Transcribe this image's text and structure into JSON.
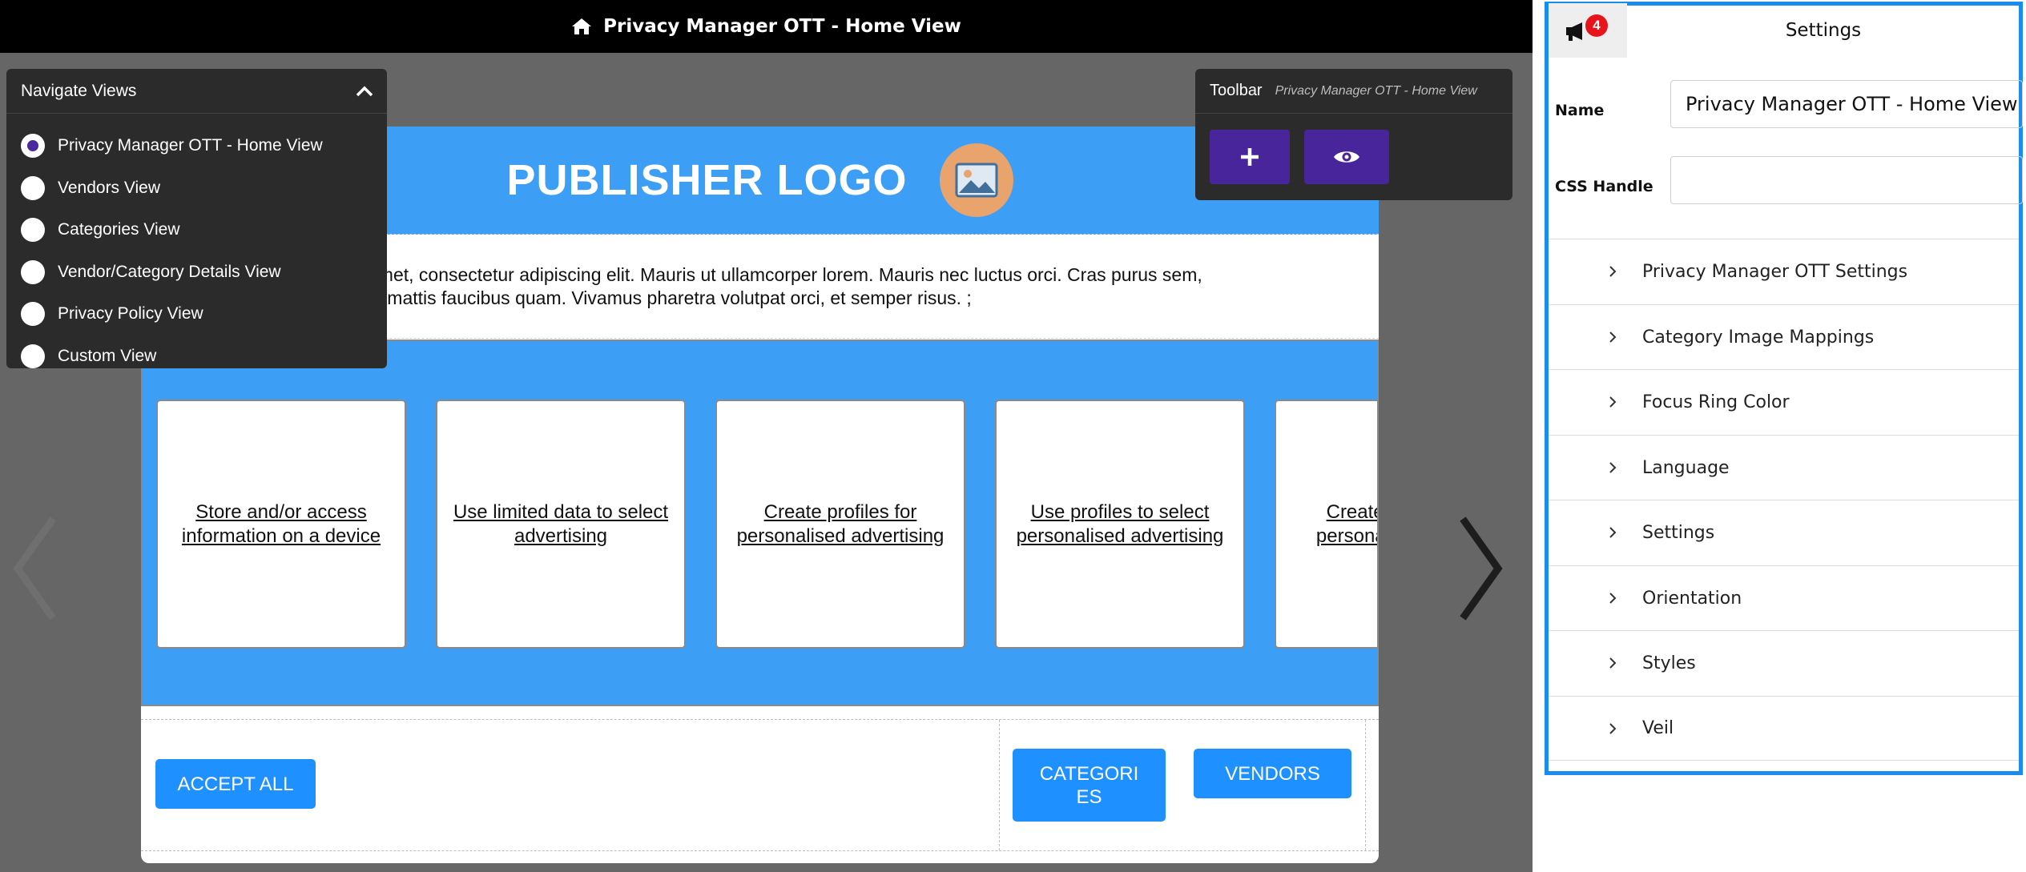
{
  "topbar": {
    "title": "Privacy Manager OTT - Home View",
    "icon": "home-icon"
  },
  "nav_panel": {
    "title": "Navigate Views",
    "items": [
      {
        "label": "Privacy Manager OTT - Home View",
        "selected": true
      },
      {
        "label": "Vendors View",
        "selected": false
      },
      {
        "label": "Categories View",
        "selected": false
      },
      {
        "label": "Vendor/Category Details View",
        "selected": false
      },
      {
        "label": "Privacy Policy View",
        "selected": false
      },
      {
        "label": "Custom View",
        "selected": false
      }
    ]
  },
  "toolbar": {
    "title": "Toolbar",
    "subtitle": "Privacy Manager OTT - Home View",
    "buttons": [
      "plus-icon",
      "eye-icon"
    ]
  },
  "preview": {
    "logo_text": "PUBLISHER LOGO",
    "description_line1": "amet, consectetur adipiscing elit. Mauris ut ullamcorper lorem. Mauris nec luctus orci. Cras purus sem,",
    "description_line2": "c, mattis faucibus quam. Vivamus pharetra volutpat orci, et semper risus. ;",
    "categories": [
      "Store and/or access information on a device",
      "Use limited data to select advertising",
      "Create profiles for personalised advertising",
      "Use profiles to select personalised advertising",
      "Create profiles to personalise content"
    ],
    "accept_all_label": "ACCEPT ALL",
    "categories_label": "CATEGORI ES",
    "vendors_label": "VENDORS",
    "colors": {
      "brand_blue": "#3d9ef5",
      "button_blue": "#1e90ff"
    }
  },
  "settings": {
    "title": "Settings",
    "notification_count": "4",
    "name_label": "Name",
    "name_value": "Privacy Manager OTT - Home View",
    "css_handle_label": "CSS Handle",
    "css_handle_value": "",
    "sections": [
      "Privacy Manager OTT Settings",
      "Category Image Mappings",
      "Focus Ring Color",
      "Language",
      "Settings",
      "Orientation",
      "Styles",
      "Veil"
    ],
    "accent_color": "#1a8cf0"
  }
}
